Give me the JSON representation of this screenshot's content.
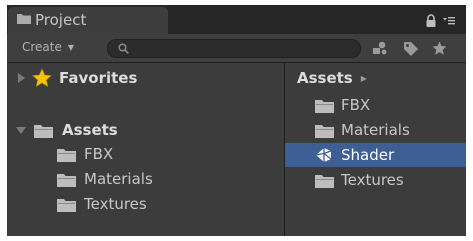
{
  "tab": {
    "title": "Project"
  },
  "toolbar": {
    "create_label": "Create"
  },
  "tree": {
    "favorites": "Favorites",
    "assets": "Assets",
    "children": [
      "FBX",
      "Materials",
      "Textures"
    ]
  },
  "content": {
    "breadcrumb": "Assets",
    "items": [
      {
        "label": "FBX",
        "icon": "folder-icon"
      },
      {
        "label": "Materials",
        "icon": "folder-icon"
      },
      {
        "label": "Shader",
        "icon": "unity-shader-icon",
        "selected": true
      },
      {
        "label": "Textures",
        "icon": "folder-icon"
      }
    ]
  },
  "colors": {
    "selection": "#3e5f96",
    "background": "#3c3c3c"
  }
}
